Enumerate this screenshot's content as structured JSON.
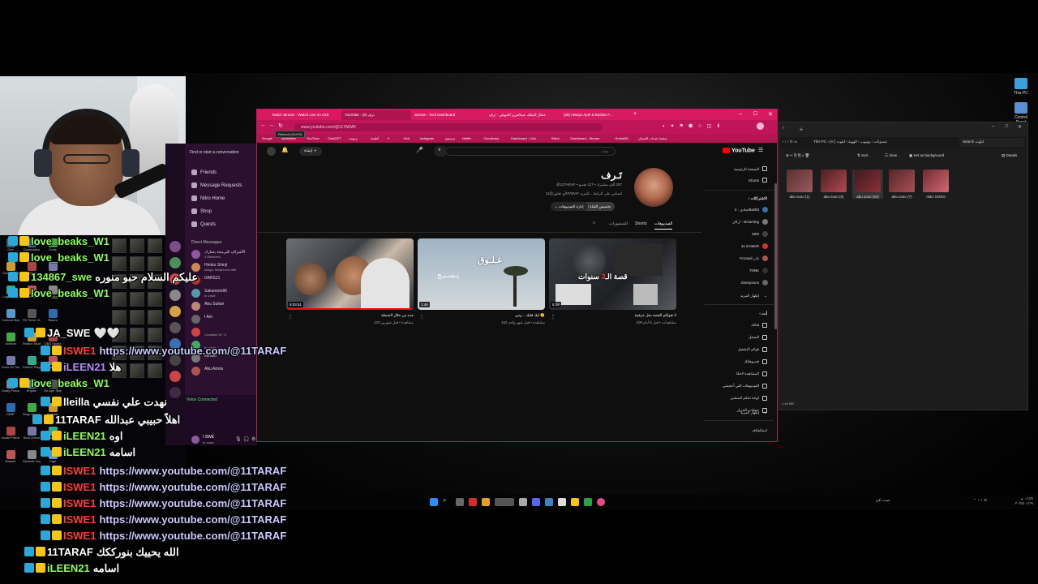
{
  "colors": {
    "accent_pink": "#d81b60",
    "yt_red": "#ff0000",
    "chat_green": "#8dff5a",
    "chat_red": "#ff3b3b",
    "chat_purple": "#b889ff",
    "discord_bg": "#2b1030"
  },
  "discord": {
    "search_placeholder": "Find or start a conversation",
    "nav": [
      "Friends",
      "Message Requests",
      "Nitro Home",
      "Shop",
      "Quests"
    ],
    "dm_header": "Direct Messages",
    "dms": [
      {
        "name": "الأشراف للبرمجة بثمارك",
        "status": "3 Members"
      },
      {
        "name": "Hiroko Shinji",
        "status": "Ichigo: What's the diffi"
      },
      {
        "name": "DARS21",
        "status": ""
      },
      {
        "name": "Sakamoto96",
        "status": "In voice"
      },
      {
        "name": "Abu Sultan",
        "status": ""
      },
      {
        "name": "I Am",
        "status": ""
      },
      {
        "name": "",
        "status": "Crossfair V2 +1"
      },
      {
        "name": "",
        "status": "In voice"
      },
      {
        "name": "Minato",
        "status": ""
      },
      {
        "name": "Abu Amira",
        "status": ""
      }
    ],
    "voice_connected": "Voice Connected",
    "user_name": "I SWE",
    "user_status": "In voice"
  },
  "browser": {
    "tabs": [
      "Twitch Stream - Watch Live on Kick",
      "YouTube - ترف (2)",
      "Stream - Kick Dashboard",
      "حطاز المثلك عبدالعزيز الحويلي - ترف",
      "(28) Always April & Bashar F...",
      "+"
    ],
    "tooltip": "Refresh (Ctrl+R)",
    "url": "www.youtube.com/@11TARAF",
    "bookmarks": [
      "Google",
      "Speedtest",
      "YouTube",
      "ChatGPT",
      "بريونيه",
      "أطعمة",
      "X",
      "Kick",
      "Instagram",
      "مرسوم",
      "Netflix",
      "Cloudinary",
      "Dashboard - Kick",
      "Stitch",
      "Dashboard - Stream",
      "Ordeal69",
      "صفحة حساب الضمان"
    ],
    "youtube": {
      "logo_text": "YouTube",
      "search_placeholder": "بحث",
      "create_label": "إنشاء",
      "channel": {
        "name": "تَـرف",
        "handle_meta": "@11TARAF • ‏287 ألف مشترك • ‏117 فيديو",
        "description": "لأي تعاون@11TARAF لسنابي على الرابط ...المزيد",
        "btn_customize": "تخصيص القناة",
        "btn_manage": "إدارة الفيديوهات",
        "btn_extra": "اشتراكاتي"
      },
      "tabs": [
        "الفيديوهات",
        "Shorts",
        "المنشورات"
      ],
      "videos": [
        {
          "title": "جده من خلال الشنطة",
          "views": "123 مشاهدة • قبل شهرين",
          "duration": "8:03:51"
        },
        {
          "title": "ليك قلبك... ونبي 😊",
          "views": "162 مشاهدة • قبل شهر واحد",
          "duration": "1:45"
        },
        {
          "title": "لا تقولكم القصة بحل عرفتية",
          "views": "108 مشاهدات • قبل 5 أيام",
          "duration": "5:18"
        }
      ],
      "sidebar": {
        "home": "الصفحة الرئيسية",
        "shorts": "Shorts",
        "subs_header": "الاشتراكات",
        "subs": [
          "جنادي - 3BadDI",
          "اركان - BGaming",
          "3ZM",
          "4x GAMeR",
          "7mzawii نادر",
          "7NNK",
          "2Seepsons"
        ],
        "show_more": "إظهار المزيد",
        "you_header": "أنت",
        "you_items": [
          "قناتك",
          "السجل",
          "قوائم التشغيل",
          "فيديوهاتك",
          "المشاهدة لاحقًا",
          "الفيديوهات التي أعجبتني",
          "لوحة تحكم المنشئ",
          "عمليات التنزيل"
        ],
        "show_less": "إظهار المزيد",
        "explore": "استكشاف"
      }
    }
  },
  "explorer": {
    "breadcrumb": [
      "This PC",
      "(A:) عمدوثات",
      "يوتيوب",
      "الهوية",
      "ابلوت"
    ],
    "search_placeholder": "Search ابلوت",
    "toolbar": [
      "Sort",
      "View",
      "Set as background",
      "Details"
    ],
    "files": [
      "abu soso (1)",
      "abu soso (6)",
      "abu soso (60)",
      "abu soso (7)",
      "ABU SOSO"
    ],
    "footer": "1.48 MB"
  },
  "desktop_right": {
    "this_pc": "This PC",
    "control_panel": "Control Panel"
  },
  "taskbar": {
    "weather": "حبث ذكئ",
    "time": "٠٤:٤٩ م",
    "date": "٢٠٢٥/٠١/١٩"
  },
  "chat": [
    {
      "user": "love_beaks_W1",
      "msg": "",
      "color": "#8dff5a"
    },
    {
      "user": "love_beaks_W1",
      "msg": "",
      "color": "#8dff5a"
    },
    {
      "user": "134867_swe",
      "msg": "عليكم السلام حبو منوره",
      "color": "#8dff5a"
    },
    {
      "user": "love_beaks_W1",
      "msg": "",
      "color": "#8dff5a"
    },
    {
      "user": "JA_SWE",
      "msg": "🤍🤍",
      "color": "#ffffff"
    },
    {
      "user": "ISWE1",
      "msg": "https://www.youtube.com/@11TARAF",
      "color": "#ff3b3b"
    },
    {
      "user": "iLEEN21",
      "msg": "هلا",
      "color": "#b889ff"
    },
    {
      "user": "love_beaks_W1",
      "msg": "",
      "color": "#8dff5a"
    },
    {
      "user": "lleilla",
      "msg": "نهدت علي نفسي",
      "color": "#ffffff"
    },
    {
      "user": "11TARAF",
      "msg": "اهلاً حبيبي عبدالله",
      "color": "#ffffff"
    },
    {
      "user": "iLEEN21",
      "msg": "اوه",
      "color": "#8dff5a"
    },
    {
      "user": "iLEEN21",
      "msg": "اسامه",
      "color": "#8dff5a"
    },
    {
      "user": "ISWE1",
      "msg": "https://www.youtube.com/@11TARAF",
      "color": "#ff3b3b"
    },
    {
      "user": "ISWE1",
      "msg": "https://www.youtube.com/@11TARAF",
      "color": "#ff3b3b"
    },
    {
      "user": "ISWE1",
      "msg": "https://www.youtube.com/@11TARAF",
      "color": "#ff3b3b"
    },
    {
      "user": "ISWE1",
      "msg": "https://www.youtube.com/@11TARAF",
      "color": "#ff3b3b"
    },
    {
      "user": "ISWE1",
      "msg": "https://www.youtube.com/@11TARAF",
      "color": "#ff3b3b"
    },
    {
      "user": "11TARAF",
      "msg": "الله يحييك بنورككك",
      "color": "#ffffff"
    },
    {
      "user": "iLEEN21",
      "msg": "اسامه",
      "color": "#8dff5a"
    }
  ],
  "obs_labels": [
    "One",
    "Domination",
    "Code",
    "One-armed",
    "NVIDIA",
    "Dark",
    "Logitech G",
    "samy",
    "Desktop",
    "Content Manager",
    "Pit There Yet",
    "Steam",
    "Scribus",
    "Roblox Studio",
    "OBS Studio",
    "Sons Of The Forest",
    "Roblox Player",
    "Streamlabs Desktop",
    "Dusty Prologue",
    "Engine",
    "Go Ape Ship",
    "GIMP",
    "Wrap House Simulator",
    "Fortnite",
    "Avast Premium",
    "Boor Demo",
    "Discord",
    "Balatro",
    "Stumble Guys",
    "Vigil"
  ]
}
